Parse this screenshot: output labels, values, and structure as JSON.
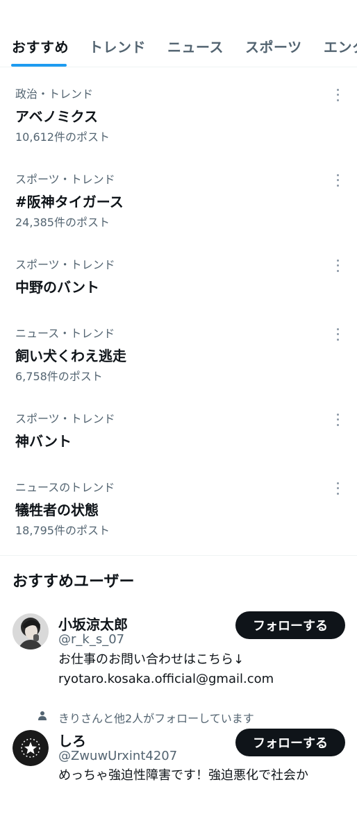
{
  "tabs": [
    {
      "label": "おすすめ",
      "active": true
    },
    {
      "label": "トレンド",
      "active": false
    },
    {
      "label": "ニュース",
      "active": false
    },
    {
      "label": "スポーツ",
      "active": false
    },
    {
      "label": "エンタ",
      "active": false
    }
  ],
  "trends": [
    {
      "meta": "政治・トレンド",
      "name": "アベノミクス",
      "count": "10,612件のポスト"
    },
    {
      "meta": "スポーツ・トレンド",
      "name": "#阪神タイガース",
      "count": "24,385件のポスト"
    },
    {
      "meta": "スポーツ・トレンド",
      "name": "中野のバント",
      "count": ""
    },
    {
      "meta": "ニュース・トレンド",
      "name": "飼い犬くわえ逃走",
      "count": "6,758件のポスト"
    },
    {
      "meta": "スポーツ・トレンド",
      "name": "神バント",
      "count": ""
    },
    {
      "meta": "ニュースのトレンド",
      "name": "犠牲者の状態",
      "count": "18,795件のポスト"
    }
  ],
  "recommended": {
    "title": "おすすめユーザー",
    "users": [
      {
        "name": "小坂涼太郎",
        "handle": "@r_k_s_07",
        "bio_line1": "お仕事のお問い合わせはこちら↓",
        "bio_line2": "ryotaro.kosaka.official@gmail.com",
        "follow_label": "フォローする",
        "avatar_icon": "portrait-photo"
      },
      {
        "social_context": "きりさんと他2人がフォローしています",
        "name": "しろ",
        "handle": "@ZwuwUrxint4207",
        "bio_line1": "めっちゃ強迫性障害です！強迫悪化で社会か",
        "follow_label": "フォローする",
        "avatar_icon": "star-badge-icon"
      }
    ]
  },
  "colors": {
    "accent": "#1d9bf0",
    "text_primary": "#0f1419",
    "text_secondary": "#536471",
    "button_bg": "#0f1419"
  }
}
